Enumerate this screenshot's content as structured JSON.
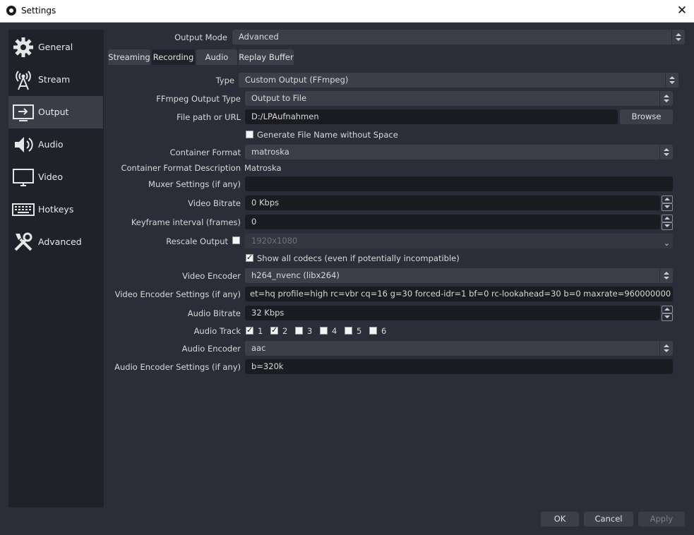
{
  "window": {
    "title": "Settings",
    "close_glyph": "✕"
  },
  "sidebar": {
    "items": [
      {
        "label": "General",
        "icon": "gear-icon"
      },
      {
        "label": "Stream",
        "icon": "antenna-icon"
      },
      {
        "label": "Output",
        "icon": "output-icon"
      },
      {
        "label": "Audio",
        "icon": "speaker-icon"
      },
      {
        "label": "Video",
        "icon": "monitor-icon"
      },
      {
        "label": "Hotkeys",
        "icon": "keyboard-icon"
      },
      {
        "label": "Advanced",
        "icon": "tools-icon"
      }
    ],
    "active": "Output"
  },
  "output_mode": {
    "label": "Output Mode",
    "value": "Advanced"
  },
  "tabs": [
    "Streaming",
    "Recording",
    "Audio",
    "Replay Buffer"
  ],
  "active_tab": "Recording",
  "form": {
    "type": {
      "label": "Type",
      "value": "Custom Output (FFmpeg)"
    },
    "ffmpeg_output_type": {
      "label": "FFmpeg Output Type",
      "value": "Output to File"
    },
    "file_path": {
      "label": "File path or URL",
      "value": "D:/LPAufnahmen",
      "browse": "Browse"
    },
    "gen_file_name": {
      "label": "Generate File Name without Space",
      "checked": false
    },
    "container_format": {
      "label": "Container Format",
      "value": "matroska"
    },
    "container_desc": {
      "label": "Container Format Description",
      "value": "Matroska"
    },
    "muxer_settings": {
      "label": "Muxer Settings (if any)",
      "value": ""
    },
    "video_bitrate": {
      "label": "Video Bitrate",
      "value": "0 Kbps"
    },
    "keyframe_interval": {
      "label": "Keyframe interval (frames)",
      "value": "0"
    },
    "rescale_output": {
      "label": "Rescale Output",
      "checked": false,
      "value": "1920x1080"
    },
    "show_all_codecs": {
      "label": "Show all codecs (even if potentially incompatible)",
      "checked": true
    },
    "video_encoder": {
      "label": "Video Encoder",
      "value": "h264_nvenc (libx264)"
    },
    "video_encoder_settings": {
      "label": "Video Encoder Settings (if any)",
      "value": "et=hq profile=high rc=vbr cq=16 g=30 forced-idr=1 bf=0 rc-lookahead=30 b=0 maxrate=960000000 bufsize=960000000"
    },
    "audio_bitrate": {
      "label": "Audio Bitrate",
      "value": "32 Kbps"
    },
    "audio_track": {
      "label": "Audio Track",
      "tracks": [
        {
          "num": "1",
          "checked": true
        },
        {
          "num": "2",
          "checked": true
        },
        {
          "num": "3",
          "checked": false
        },
        {
          "num": "4",
          "checked": false
        },
        {
          "num": "5",
          "checked": false
        },
        {
          "num": "6",
          "checked": false
        }
      ]
    },
    "audio_encoder": {
      "label": "Audio Encoder",
      "value": "aac"
    },
    "audio_encoder_settings": {
      "label": "Audio Encoder Settings (if any)",
      "value": "b=320k"
    }
  },
  "footer": {
    "ok": "OK",
    "cancel": "Cancel",
    "apply": "Apply"
  }
}
